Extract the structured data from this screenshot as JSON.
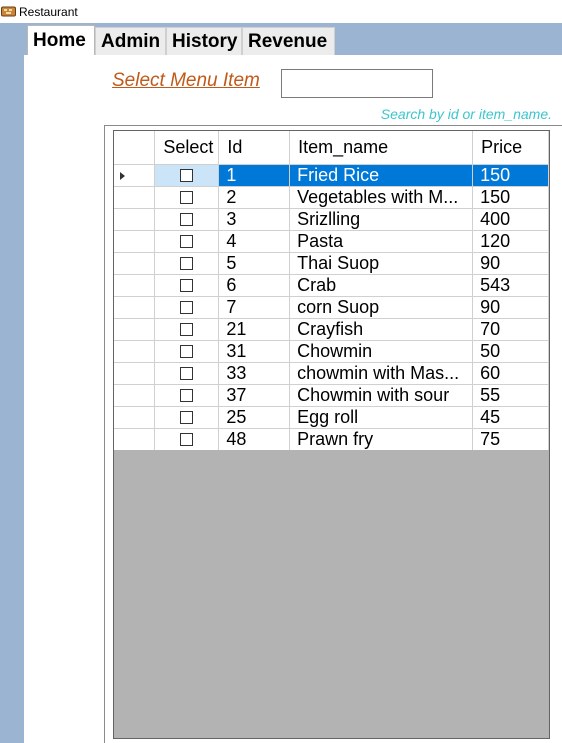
{
  "window": {
    "title": "Restaurant",
    "icon": "restaurant-app-icon"
  },
  "tabs": [
    {
      "label": "Home",
      "active": true
    },
    {
      "label": "Admin",
      "active": false
    },
    {
      "label": "History",
      "active": false
    },
    {
      "label": "Revenue",
      "active": false
    }
  ],
  "home": {
    "select_label": "Select Menu Item",
    "search_value": "",
    "search_hint": "Search by id or item_name."
  },
  "grid": {
    "columns": [
      "Select",
      "Id",
      "Item_name",
      "Price"
    ],
    "rows": [
      {
        "id": "1",
        "item_name": "Fried Rice",
        "price": "150",
        "selected": true,
        "checked": false
      },
      {
        "id": "2",
        "item_name": "Vegetables with M...",
        "price": "150",
        "selected": false,
        "checked": false
      },
      {
        "id": "3",
        "item_name": "Srizlling",
        "price": "400",
        "selected": false,
        "checked": false
      },
      {
        "id": "4",
        "item_name": "Pasta",
        "price": "120",
        "selected": false,
        "checked": false
      },
      {
        "id": "5",
        "item_name": "Thai Suop",
        "price": "90",
        "selected": false,
        "checked": false
      },
      {
        "id": "6",
        "item_name": "Crab",
        "price": "543",
        "selected": false,
        "checked": false
      },
      {
        "id": "7",
        "item_name": "corn Suop",
        "price": "90",
        "selected": false,
        "checked": false
      },
      {
        "id": "21",
        "item_name": "Crayfish",
        "price": "70",
        "selected": false,
        "checked": false
      },
      {
        "id": "31",
        "item_name": "Chowmin",
        "price": "50",
        "selected": false,
        "checked": false
      },
      {
        "id": "33",
        "item_name": "chowmin with Mas...",
        "price": "60",
        "selected": false,
        "checked": false
      },
      {
        "id": "37",
        "item_name": "Chowmin with sour",
        "price": "55",
        "selected": false,
        "checked": false
      },
      {
        "id": "25",
        "item_name": "Egg roll",
        "price": "45",
        "selected": false,
        "checked": false
      },
      {
        "id": "48",
        "item_name": "Prawn fry",
        "price": "75",
        "selected": false,
        "checked": false
      }
    ]
  },
  "colors": {
    "accent": "#0078d7",
    "sidebar": "#9bb4d1",
    "label": "#c05a1a",
    "hint": "#3cc6cc",
    "grid_empty": "#b3b3b3"
  }
}
